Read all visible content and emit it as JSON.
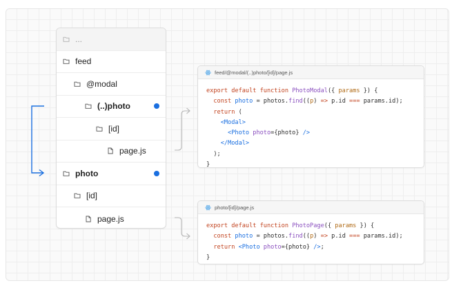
{
  "tree": {
    "rows": [
      {
        "label": "...",
        "icon": "folder-icon",
        "bold": false,
        "highlight": false
      },
      {
        "label": "feed",
        "icon": "folder-icon",
        "bold": false,
        "highlight": false
      },
      {
        "label": "@modal",
        "icon": "folder-icon",
        "bold": false,
        "highlight": false
      },
      {
        "label": "(..)photo",
        "icon": "folder-icon",
        "bold": true,
        "highlight": true
      },
      {
        "label": "[id]",
        "icon": "folder-icon",
        "bold": false,
        "highlight": false
      },
      {
        "label": "page.js",
        "icon": "file-icon",
        "bold": false,
        "highlight": false
      },
      {
        "label": "photo",
        "icon": "folder-icon",
        "bold": true,
        "highlight": true
      },
      {
        "label": "[id]",
        "icon": "folder-icon",
        "bold": false,
        "highlight": false
      },
      {
        "label": "page.js",
        "icon": "file-icon",
        "bold": false,
        "highlight": false
      }
    ]
  },
  "cards": [
    {
      "filename": "feed/@modal/(..)photo/[id]/page.js",
      "icon": "react-icon",
      "lines": [
        [
          {
            "t": "export default function ",
            "c": "kw"
          },
          {
            "t": "PhotoModal",
            "c": "fn"
          },
          {
            "t": "({ ",
            "c": ""
          },
          {
            "t": "params",
            "c": "pm"
          },
          {
            "t": " }) {",
            "c": ""
          }
        ],
        [
          {
            "t": "  const ",
            "c": "kw"
          },
          {
            "t": "photo",
            "c": "tag"
          },
          {
            "t": " = photos.",
            "c": ""
          },
          {
            "t": "find",
            "c": "fn"
          },
          {
            "t": "((",
            "c": ""
          },
          {
            "t": "p",
            "c": "pm"
          },
          {
            "t": ") ",
            "c": ""
          },
          {
            "t": "=>",
            "c": "kw"
          },
          {
            "t": " p.id ",
            "c": ""
          },
          {
            "t": "===",
            "c": "kw"
          },
          {
            "t": " params.id);",
            "c": ""
          }
        ],
        [
          {
            "t": "  return ",
            "c": "kw"
          },
          {
            "t": "(",
            "c": ""
          }
        ],
        [
          {
            "t": "    <Modal>",
            "c": "tag"
          }
        ],
        [
          {
            "t": "      <Photo ",
            "c": "tag"
          },
          {
            "t": "photo",
            "c": "fn"
          },
          {
            "t": "={photo} ",
            "c": ""
          },
          {
            "t": "/>",
            "c": "tag"
          }
        ],
        [
          {
            "t": "    </Modal>",
            "c": "tag"
          }
        ],
        [
          {
            "t": "  );",
            "c": ""
          }
        ],
        [
          {
            "t": "}",
            "c": ""
          }
        ]
      ]
    },
    {
      "filename": "photo/[id]/page.js",
      "icon": "react-icon",
      "lines": [
        [
          {
            "t": "export default function ",
            "c": "kw"
          },
          {
            "t": "PhotoPage",
            "c": "fn"
          },
          {
            "t": "({ ",
            "c": ""
          },
          {
            "t": "params",
            "c": "pm"
          },
          {
            "t": " }) {",
            "c": ""
          }
        ],
        [
          {
            "t": "  const ",
            "c": "kw"
          },
          {
            "t": "photo",
            "c": "tag"
          },
          {
            "t": " = photos.",
            "c": ""
          },
          {
            "t": "find",
            "c": "fn"
          },
          {
            "t": "((",
            "c": ""
          },
          {
            "t": "p",
            "c": "pm"
          },
          {
            "t": ") ",
            "c": ""
          },
          {
            "t": "=>",
            "c": "kw"
          },
          {
            "t": " p.id ",
            "c": ""
          },
          {
            "t": "===",
            "c": "kw"
          },
          {
            "t": " params.id);",
            "c": ""
          }
        ],
        [
          {
            "t": "  return ",
            "c": "kw"
          },
          {
            "t": "<Photo ",
            "c": "tag"
          },
          {
            "t": "photo",
            "c": "fn"
          },
          {
            "t": "={photo} ",
            "c": ""
          },
          {
            "t": "/>",
            "c": "tag"
          },
          {
            "t": ";",
            "c": ""
          }
        ],
        [
          {
            "t": "}",
            "c": ""
          }
        ]
      ]
    }
  ],
  "colors": {
    "accent": "#1a6fe0",
    "connector_gray": "#b5b5b5"
  }
}
